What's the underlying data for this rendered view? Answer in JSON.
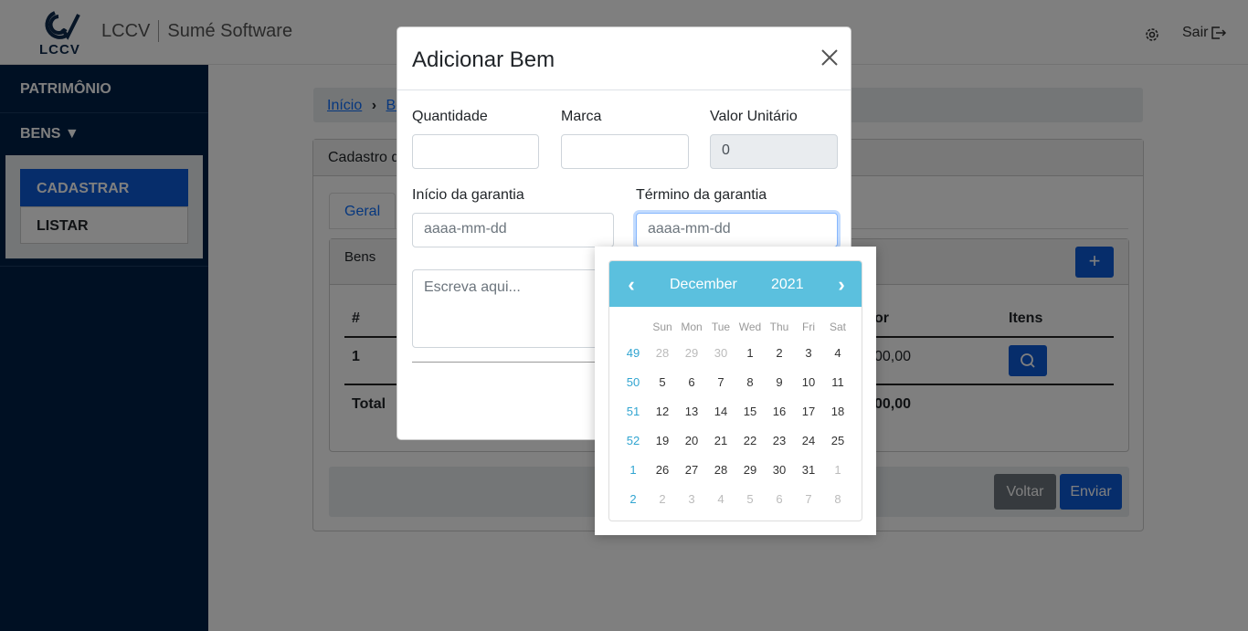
{
  "topbar": {
    "logo_text": "LCCV",
    "app_name": "LCCV",
    "app_subtitle": "Sumé Software",
    "logout_label": "Sair"
  },
  "sidebar": {
    "title": "PATRIMÔNIO",
    "group": "BENS ▼",
    "items": [
      {
        "label": "CADASTRAR",
        "active": true
      },
      {
        "label": "LISTAR",
        "active": false
      }
    ]
  },
  "breadcrumb": {
    "items": [
      "Início",
      "Be"
    ]
  },
  "main": {
    "card_title": "Cadastro d",
    "tabs": [
      "Geral"
    ],
    "bens_title": "Bens",
    "table": {
      "headers": [
        "#",
        "or",
        "Itens"
      ],
      "row": {
        "num": "1",
        "valor": "00,00"
      },
      "total_label": "Total",
      "total_value": "00,00"
    },
    "buttons": {
      "back": "Voltar",
      "submit": "Enviar"
    }
  },
  "modal": {
    "title": "Adicionar Bem",
    "fields": {
      "quantidade": {
        "label": "Quantidade",
        "value": ""
      },
      "marca": {
        "label": "Marca",
        "value": ""
      },
      "valor_unitario": {
        "label": "Valor Unitário",
        "value": "0"
      },
      "inicio_garantia": {
        "label": "Início da garantia",
        "placeholder": "aaaa-mm-dd"
      },
      "termino_garantia": {
        "label": "Término da garantia",
        "placeholder": "aaaa-mm-dd"
      },
      "descricao": {
        "placeholder": "Escreva aqui..."
      }
    }
  },
  "datepicker": {
    "month": "December",
    "year": "2021",
    "prev": "‹",
    "next": "›",
    "day_names": [
      "Sun",
      "Mon",
      "Tue",
      "Wed",
      "Thu",
      "Fri",
      "Sat"
    ],
    "weeks": [
      {
        "week": "49",
        "days": [
          {
            "d": "28",
            "m": true
          },
          {
            "d": "29",
            "m": true
          },
          {
            "d": "30",
            "m": true
          },
          {
            "d": "1"
          },
          {
            "d": "2"
          },
          {
            "d": "3"
          },
          {
            "d": "4"
          }
        ]
      },
      {
        "week": "50",
        "days": [
          {
            "d": "5"
          },
          {
            "d": "6"
          },
          {
            "d": "7"
          },
          {
            "d": "8"
          },
          {
            "d": "9"
          },
          {
            "d": "10"
          },
          {
            "d": "11"
          }
        ]
      },
      {
        "week": "51",
        "days": [
          {
            "d": "12"
          },
          {
            "d": "13"
          },
          {
            "d": "14"
          },
          {
            "d": "15"
          },
          {
            "d": "16"
          },
          {
            "d": "17"
          },
          {
            "d": "18"
          }
        ]
      },
      {
        "week": "52",
        "days": [
          {
            "d": "19"
          },
          {
            "d": "20"
          },
          {
            "d": "21"
          },
          {
            "d": "22"
          },
          {
            "d": "23"
          },
          {
            "d": "24"
          },
          {
            "d": "25"
          }
        ]
      },
      {
        "week": "1",
        "days": [
          {
            "d": "26"
          },
          {
            "d": "27"
          },
          {
            "d": "28"
          },
          {
            "d": "29"
          },
          {
            "d": "30"
          },
          {
            "d": "31"
          },
          {
            "d": "1",
            "m": true
          }
        ]
      },
      {
        "week": "2",
        "days": [
          {
            "d": "2",
            "m": true
          },
          {
            "d": "3",
            "m": true
          },
          {
            "d": "4",
            "m": true
          },
          {
            "d": "5",
            "m": true
          },
          {
            "d": "6",
            "m": true
          },
          {
            "d": "7",
            "m": true
          },
          {
            "d": "8",
            "m": true
          }
        ]
      }
    ]
  },
  "colors": {
    "sidebar_bg": "#002147",
    "primary": "#0d5bd7",
    "datepicker_header": "#5bc0de",
    "secondary": "#6c757d"
  }
}
